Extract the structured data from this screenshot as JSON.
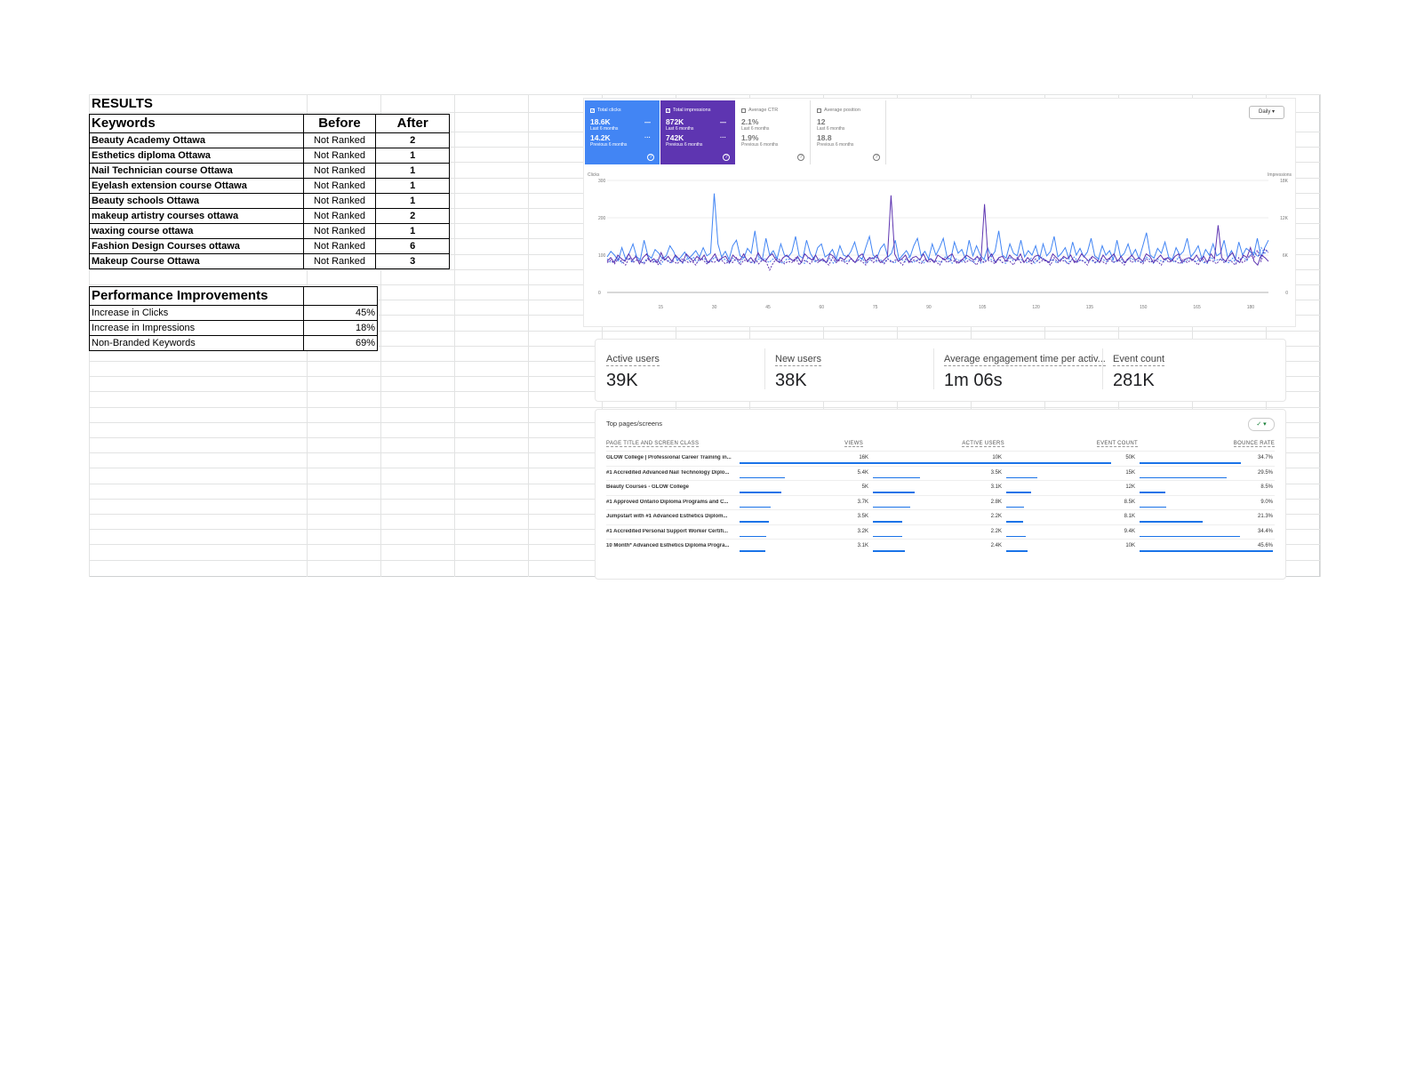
{
  "sheet": {
    "results_title": "RESULTS",
    "keywords_table": {
      "headers": [
        "Keywords",
        "Before",
        "After"
      ],
      "rows": [
        {
          "keyword": "Beauty Academy Ottawa",
          "before": "Not Ranked",
          "after": "2"
        },
        {
          "keyword": "Esthetics diploma Ottawa",
          "before": "Not Ranked",
          "after": "1"
        },
        {
          "keyword": "Nail Technician course Ottawa",
          "before": "Not Ranked",
          "after": "1"
        },
        {
          "keyword": "Eyelash extension course Ottawa",
          "before": "Not Ranked",
          "after": "1"
        },
        {
          "keyword": "Beauty schools Ottawa",
          "before": "Not Ranked",
          "after": "1"
        },
        {
          "keyword": "makeup artistry courses ottawa",
          "before": "Not Ranked",
          "after": "2"
        },
        {
          "keyword": "waxing course ottawa",
          "before": "Not Ranked",
          "after": "1"
        },
        {
          "keyword": "Fashion Design Courses ottawa",
          "before": "Not Ranked",
          "after": "6"
        },
        {
          "keyword": "Makeup Course Ottawa",
          "before": "Not Ranked",
          "after": "3"
        }
      ]
    },
    "performance_table": {
      "header": "Performance Improvements",
      "rows": [
        {
          "label": "Increase in Clicks",
          "value": "45%"
        },
        {
          "label": "Increase in Impressions",
          "value": "18%"
        },
        {
          "label": "Non-Branded Keywords",
          "value": "69%"
        }
      ]
    }
  },
  "search_console": {
    "cards": [
      {
        "label": "Total clicks",
        "value": "18.6K",
        "period": "Last 6 months",
        "prev_value": "14.2K",
        "prev_period": "Previous 6 months",
        "checked": true,
        "color": "#4285f4"
      },
      {
        "label": "Total impressions",
        "value": "872K",
        "period": "Last 6 months",
        "prev_value": "742K",
        "prev_period": "Previous 6 months",
        "checked": true,
        "color": "#5e35b1"
      },
      {
        "label": "Average CTR",
        "value": "2.1%",
        "period": "Last 6 months",
        "prev_value": "1.9%",
        "prev_period": "Previous 6 months",
        "checked": false
      },
      {
        "label": "Average position",
        "value": "12",
        "period": "Last 6 months",
        "prev_value": "18.8",
        "prev_period": "Previous 6 months",
        "checked": false
      }
    ],
    "granularity": "Daily"
  },
  "chart_data": {
    "type": "line",
    "left_axis_label": "Clicks",
    "right_axis_label": "Impressions",
    "left_ticks": [
      "300",
      "200",
      "100",
      "0"
    ],
    "right_ticks": [
      "18K",
      "12K",
      "6K",
      "0"
    ],
    "x_ticks": [
      "15",
      "30",
      "45",
      "60",
      "75",
      "90",
      "105",
      "120",
      "135",
      "150",
      "165",
      "180"
    ],
    "ylim_left": [
      0,
      300
    ],
    "ylim_right": [
      0,
      18000
    ],
    "xlim": [
      0,
      185
    ],
    "series": [
      {
        "axis": "left",
        "color": "#4285f4",
        "dashed": false,
        "values": [
          95,
          110,
          100,
          85,
          120,
          90,
          105,
          130,
          95,
          88,
          140,
          100,
          92,
          115,
          105,
          90,
          98,
          125,
          110,
          85,
          95,
          108,
          90,
          100,
          112,
          95,
          120,
          98,
          105,
          265,
          130,
          95,
          110,
          88,
          125,
          140,
          98,
          92,
          118,
          105,
          165,
          95,
          88,
          145,
          100,
          112,
          90,
          130,
          100,
          95,
          108,
          150,
          98,
          92,
          140,
          105,
          88,
          120,
          130,
          95,
          102,
          115,
          90,
          125,
          100,
          95,
          110,
          135,
          98,
          88,
          120,
          150,
          100,
          92,
          118,
          130,
          95,
          105,
          140,
          88,
          100,
          112,
          95,
          125,
          145,
          98,
          110,
          90,
          130,
          100,
          120,
          145,
          95,
          88,
          135,
          105,
          115,
          90,
          140,
          98,
          125,
          100,
          88,
          120,
          95,
          110,
          165,
          100,
          92,
          130,
          105,
          98,
          140,
          95,
          112,
          100,
          125,
          88,
          130,
          98,
          110,
          150,
          95,
          105,
          120,
          90,
          135,
          100,
          118,
          95,
          108,
          145,
          98,
          90,
          125,
          100,
          112,
          88,
          140,
          95,
          105,
          130,
          98,
          115,
          90,
          125,
          160,
          100,
          92,
          118,
          105,
          135,
          95,
          88,
          120,
          100,
          110,
          145,
          95,
          108,
          125,
          90,
          115,
          100,
          130,
          98,
          105,
          140,
          92,
          112,
          88,
          135,
          100,
          118,
          110,
          100,
          145,
          95,
          120,
          140
        ]
      },
      {
        "axis": "left",
        "color": "#4285f4",
        "dashed": true,
        "values": [
          90,
          80,
          85,
          95,
          78,
          88,
          92,
          80,
          100,
          85,
          78,
          90,
          95,
          82,
          88,
          75,
          92,
          85,
          80,
          98,
          88,
          78,
          90,
          85,
          95,
          80,
          88,
          92,
          78,
          85,
          95,
          82,
          90,
          88,
          78,
          92,
          85,
          80,
          95,
          88,
          82,
          78,
          90,
          85,
          92,
          80,
          88,
          95,
          82,
          78,
          90,
          88,
          85,
          92,
          80,
          78,
          95,
          88,
          82,
          90,
          85,
          80,
          92,
          78,
          88,
          95,
          82,
          85,
          90,
          80,
          88,
          92,
          78,
          85,
          95,
          82,
          88,
          80,
          90,
          85,
          78,
          92,
          88,
          82,
          95,
          80,
          85,
          90,
          78,
          88,
          92,
          82,
          85,
          80,
          95,
          88,
          78,
          90,
          85,
          82,
          92,
          88,
          80,
          95,
          78,
          85,
          90,
          88,
          82,
          92,
          80,
          78,
          95,
          85,
          88,
          90,
          82,
          80,
          92,
          78,
          88,
          95,
          85,
          82,
          90,
          80,
          88,
          92,
          78,
          85,
          95,
          82,
          88,
          80,
          90,
          85,
          78,
          92,
          88,
          82,
          95,
          80,
          85,
          90,
          78,
          88,
          92,
          82,
          85,
          80,
          95,
          88,
          78,
          90,
          85,
          82,
          92,
          88,
          80,
          95,
          78,
          85,
          90,
          88,
          82,
          92,
          80,
          78,
          95,
          85,
          88,
          90,
          82,
          80,
          92,
          78,
          88,
          95,
          85,
          100,
          110,
          95,
          120,
          105,
          115
        ]
      },
      {
        "axis": "right",
        "color": "#5e35b1",
        "dashed": false,
        "values": [
          5000,
          5600,
          4800,
          6000,
          5400,
          5000,
          6200,
          5200,
          5800,
          4600,
          5600,
          6200,
          5000,
          5400,
          4800,
          6400,
          5200,
          5800,
          5000,
          6000,
          5400,
          4800,
          6200,
          5600,
          5000,
          5800,
          5200,
          6000,
          4800,
          5400,
          6200,
          5000,
          5600,
          5800,
          4800,
          6000,
          5400,
          5200,
          6200,
          5000,
          5600,
          4800,
          6400,
          5400,
          5000,
          5800,
          6200,
          5200,
          4800,
          5600,
          6000,
          5400,
          5000,
          5800,
          4800,
          6200,
          5600,
          5200,
          6000,
          5000,
          5400,
          4800,
          6200,
          5800,
          5000,
          5600,
          5200,
          6000,
          5400,
          4800,
          5800,
          6200,
          5000,
          5600,
          5400,
          6000,
          4800,
          5200,
          5800,
          15600,
          6200,
          5000,
          5400,
          6000,
          4800,
          5600,
          5800,
          5200,
          6200,
          5000,
          5400,
          4800,
          6000,
          5600,
          5200,
          5800,
          6200,
          5000,
          4800,
          5400,
          6000,
          5600,
          5200,
          5800,
          5000,
          14200,
          5400,
          6200,
          4800,
          5600,
          5800,
          5000,
          6000,
          5400,
          5200,
          6200,
          4800,
          5600,
          5000,
          5800,
          6000,
          5400,
          5200,
          4800,
          6200,
          5600,
          5000,
          5800,
          5400,
          6000,
          4800,
          5200,
          6200,
          5600,
          5000,
          5800,
          5400,
          4800,
          6000,
          5200,
          5600,
          6200,
          5000,
          5800,
          4800,
          5400,
          6000,
          5200,
          5600,
          5000,
          6200,
          5800,
          4800,
          5400,
          6000,
          5200,
          5600,
          5000,
          5800,
          6200,
          4800,
          5400,
          5600,
          5200,
          6000,
          5000,
          5800,
          4800,
          6200,
          5400,
          10800,
          5600,
          5000,
          5800,
          6400,
          5200,
          4800,
          6000,
          5600,
          7200,
          5000,
          4400,
          6000,
          5600,
          5000
        ]
      },
      {
        "axis": "right",
        "color": "#5e35b1",
        "dashed": true,
        "values": [
          4800,
          5200,
          4600,
          5400,
          5000,
          4400,
          5600,
          4800,
          5200,
          5000,
          4600,
          5400,
          4800,
          5000,
          4400,
          5600,
          5200,
          4800,
          5000,
          4600,
          5400,
          5200,
          4800,
          5000,
          4400,
          5600,
          5200,
          4600,
          5000,
          4800,
          5400,
          5200,
          4600,
          5000,
          4800,
          5600,
          4400,
          5200,
          5000,
          4800,
          5400,
          4600,
          5200,
          5000,
          3600,
          4800,
          5400,
          5200,
          4600,
          5000,
          4800,
          5600,
          4400,
          5200,
          5000,
          4600,
          5400,
          4800,
          5200,
          5000,
          4400,
          5600,
          4800,
          5200,
          5000,
          4600,
          5400,
          4800,
          5200,
          5000,
          4400,
          5600,
          4800,
          5200,
          5000,
          4600,
          5400,
          4800,
          5200,
          5000,
          4400,
          5600,
          4800,
          5200,
          5000,
          4600,
          5400,
          4800,
          5200,
          5000,
          4400,
          5600,
          4800,
          5200,
          5000,
          4600,
          5400,
          4800,
          5200,
          5000,
          4400,
          5600,
          4800,
          5200,
          5000,
          4600,
          5400,
          4800,
          5200,
          5000,
          4400,
          5600,
          4800,
          5200,
          5000,
          4600,
          5400,
          4800,
          5200,
          5000,
          4400,
          5600,
          4800,
          5200,
          5000,
          4600,
          5400,
          4800,
          5200,
          5000,
          4400,
          5600,
          4800,
          5200,
          5000,
          4600,
          5400,
          4800,
          5200,
          5000,
          4400,
          5600,
          4800,
          5200,
          5000,
          4600,
          5400,
          4800,
          5200,
          5000,
          4400,
          5600,
          4800,
          5200,
          5000,
          4600,
          5400,
          4800,
          5200,
          5000,
          4400,
          5600,
          4800,
          5200,
          5000,
          4600,
          5400,
          4800,
          5200,
          5000,
          4400,
          5600,
          4800,
          5200,
          6000,
          5400,
          6800,
          5000,
          7000,
          6400
        ]
      }
    ]
  },
  "ga_summary": {
    "metrics": [
      {
        "label": "Active users",
        "value": "39K"
      },
      {
        "label": "New users",
        "value": "38K"
      },
      {
        "label": "Average engagement time per activ...",
        "value": "1m 06s"
      },
      {
        "label": "Event count",
        "value": "281K"
      }
    ]
  },
  "ga_pages": {
    "title": "Top pages/screens",
    "columns": [
      "PAGE TITLE AND SCREEN CLASS",
      "VIEWS",
      "ACTIVE USERS",
      "EVENT COUNT",
      "BOUNCE RATE"
    ],
    "rows": [
      {
        "page": "GLOW College | Professional Career Training in...",
        "views": "16K",
        "users": "10K",
        "events": "50K",
        "bounce": "34.7%",
        "views_share": 1.0,
        "users_share": 1.0,
        "events_share": 1.0,
        "bounce_share": 0.76
      },
      {
        "page": "#1 Accredited Advanced Nail Technology Diplo...",
        "views": "5.4K",
        "users": "3.5K",
        "events": "15K",
        "bounce": "29.5%",
        "views_share": 0.34,
        "users_share": 0.35,
        "events_share": 0.3,
        "bounce_share": 0.65
      },
      {
        "page": "Beauty Courses - GLOW College",
        "views": "5K",
        "users": "3.1K",
        "events": "12K",
        "bounce": "8.5%",
        "views_share": 0.31,
        "users_share": 0.31,
        "events_share": 0.24,
        "bounce_share": 0.19
      },
      {
        "page": "#1 Approved Ontario Diploma Programs and C...",
        "views": "3.7K",
        "users": "2.8K",
        "events": "8.5K",
        "bounce": "9.0%",
        "views_share": 0.23,
        "users_share": 0.28,
        "events_share": 0.17,
        "bounce_share": 0.2
      },
      {
        "page": "Jumpstart with #1 Advanced Esthetics Diplom...",
        "views": "3.5K",
        "users": "2.2K",
        "events": "8.1K",
        "bounce": "21.3%",
        "views_share": 0.22,
        "users_share": 0.22,
        "events_share": 0.16,
        "bounce_share": 0.47
      },
      {
        "page": "#1 Accredited Personal Support Worker Certifi...",
        "views": "3.2K",
        "users": "2.2K",
        "events": "9.4K",
        "bounce": "34.4%",
        "views_share": 0.2,
        "users_share": 0.22,
        "events_share": 0.19,
        "bounce_share": 0.75
      },
      {
        "page": "10 Month* Advanced Esthetics Diploma Progra...",
        "views": "3.1K",
        "users": "2.4K",
        "events": "10K",
        "bounce": "45.6%",
        "views_share": 0.19,
        "users_share": 0.24,
        "events_share": 0.2,
        "bounce_share": 1.0
      }
    ]
  }
}
